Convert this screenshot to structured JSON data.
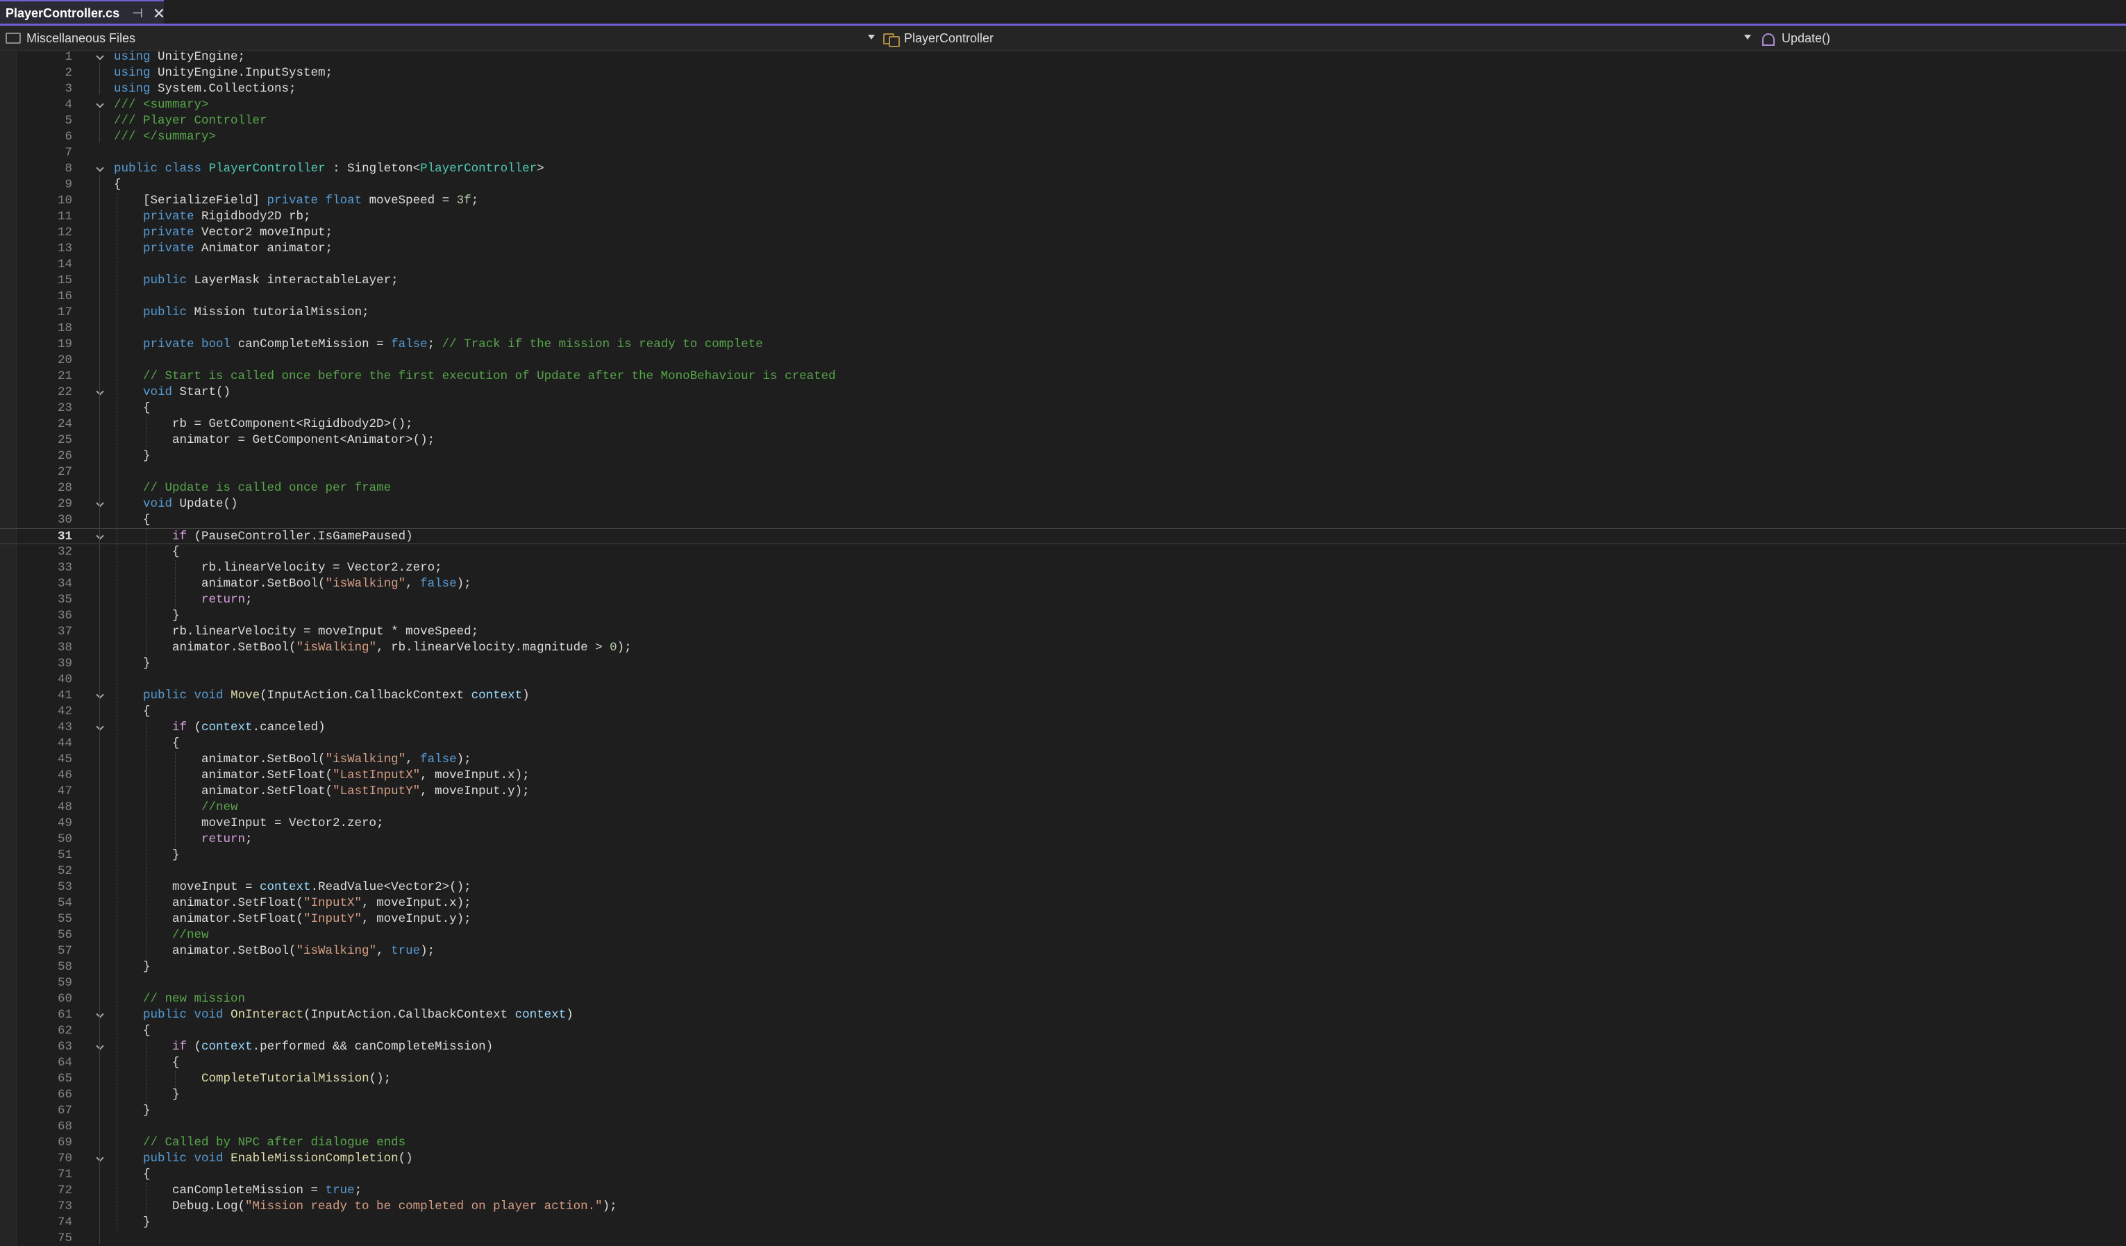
{
  "tab": {
    "title": "PlayerController.cs",
    "pin_glyph": "⊣",
    "close_glyph": "✕"
  },
  "navbar": {
    "project": "Miscellaneous Files",
    "type": "PlayerController",
    "member": "Update()"
  },
  "editor": {
    "current_line": 31,
    "lines": [
      [
        {
          "t": "using",
          "c": "kw"
        },
        {
          "t": " UnityEngine;"
        }
      ],
      [
        {
          "t": "using",
          "c": "kw"
        },
        {
          "t": " UnityEngine.InputSystem;"
        }
      ],
      [
        {
          "t": "using",
          "c": "kw"
        },
        {
          "t": " System.Collections;"
        }
      ],
      [
        {
          "t": "/// <summary>",
          "c": "cm"
        }
      ],
      [
        {
          "t": "/// Player Controller",
          "c": "cm"
        }
      ],
      [
        {
          "t": "/// </summary>",
          "c": "cm"
        }
      ],
      [],
      [
        {
          "t": "public",
          "c": "kw"
        },
        {
          "t": " "
        },
        {
          "t": "class",
          "c": "kw"
        },
        {
          "t": " "
        },
        {
          "t": "PlayerController",
          "c": "ty"
        },
        {
          "t": " : Singleton<"
        },
        {
          "t": "PlayerController",
          "c": "ty"
        },
        {
          "t": ">"
        }
      ],
      [
        {
          "t": "{"
        }
      ],
      [
        {
          "t": "    [SerializeField] "
        },
        {
          "t": "private",
          "c": "kw"
        },
        {
          "t": " "
        },
        {
          "t": "float",
          "c": "kw"
        },
        {
          "t": " moveSpeed = "
        },
        {
          "t": "3f",
          "c": "nu"
        },
        {
          "t": ";"
        }
      ],
      [
        {
          "t": "    "
        },
        {
          "t": "private",
          "c": "kw"
        },
        {
          "t": " Rigidbody2D rb;"
        }
      ],
      [
        {
          "t": "    "
        },
        {
          "t": "private",
          "c": "kw"
        },
        {
          "t": " Vector2 moveInput;"
        }
      ],
      [
        {
          "t": "    "
        },
        {
          "t": "private",
          "c": "kw"
        },
        {
          "t": " Animator animator;"
        }
      ],
      [],
      [
        {
          "t": "    "
        },
        {
          "t": "public",
          "c": "kw"
        },
        {
          "t": " LayerMask interactableLayer;"
        }
      ],
      [],
      [
        {
          "t": "    "
        },
        {
          "t": "public",
          "c": "kw"
        },
        {
          "t": " Mission tutorialMission;"
        }
      ],
      [],
      [
        {
          "t": "    "
        },
        {
          "t": "private",
          "c": "kw"
        },
        {
          "t": " "
        },
        {
          "t": "bool",
          "c": "kw"
        },
        {
          "t": " canCompleteMission = "
        },
        {
          "t": "false",
          "c": "kw"
        },
        {
          "t": "; "
        },
        {
          "t": "// Track if the mission is ready to complete",
          "c": "cm"
        }
      ],
      [],
      [
        {
          "t": "    "
        },
        {
          "t": "// Start is called once before the first execution of Update after the MonoBehaviour is created",
          "c": "cm"
        }
      ],
      [
        {
          "t": "    "
        },
        {
          "t": "void",
          "c": "kw"
        },
        {
          "t": " Start()"
        }
      ],
      [
        {
          "t": "    {"
        }
      ],
      [
        {
          "t": "        rb = GetComponent<Rigidbody2D>();"
        }
      ],
      [
        {
          "t": "        animator = GetComponent<Animator>();"
        }
      ],
      [
        {
          "t": "    }"
        }
      ],
      [],
      [
        {
          "t": "    "
        },
        {
          "t": "// Update is called once per frame",
          "c": "cm"
        }
      ],
      [
        {
          "t": "    "
        },
        {
          "t": "void",
          "c": "kw"
        },
        {
          "t": " Update()"
        }
      ],
      [
        {
          "t": "    {"
        }
      ],
      [
        {
          "t": "        "
        },
        {
          "t": "if",
          "c": "ct"
        },
        {
          "t": " (PauseController.IsGamePaused)"
        }
      ],
      [
        {
          "t": "        {"
        }
      ],
      [
        {
          "t": "            rb.linearVelocity = Vector2.zero;"
        }
      ],
      [
        {
          "t": "            animator.SetBool("
        },
        {
          "t": "\"isWalking\"",
          "c": "st"
        },
        {
          "t": ", "
        },
        {
          "t": "false",
          "c": "kw"
        },
        {
          "t": ");"
        }
      ],
      [
        {
          "t": "            "
        },
        {
          "t": "return",
          "c": "ct"
        },
        {
          "t": ";"
        }
      ],
      [
        {
          "t": "        }"
        }
      ],
      [
        {
          "t": "        rb.linearVelocity = moveInput * moveSpeed;"
        }
      ],
      [
        {
          "t": "        animator.SetBool("
        },
        {
          "t": "\"isWalking\"",
          "c": "st"
        },
        {
          "t": ", rb.linearVelocity.magnitude > "
        },
        {
          "t": "0",
          "c": "nu"
        },
        {
          "t": ");"
        }
      ],
      [
        {
          "t": "    }"
        }
      ],
      [],
      [
        {
          "t": "    "
        },
        {
          "t": "public",
          "c": "kw"
        },
        {
          "t": " "
        },
        {
          "t": "void",
          "c": "kw"
        },
        {
          "t": " "
        },
        {
          "t": "Move",
          "c": "mt"
        },
        {
          "t": "(InputAction.CallbackContext "
        },
        {
          "t": "context",
          "c": "pm"
        },
        {
          "t": ")"
        }
      ],
      [
        {
          "t": "    {"
        }
      ],
      [
        {
          "t": "        "
        },
        {
          "t": "if",
          "c": "ct"
        },
        {
          "t": " ("
        },
        {
          "t": "context",
          "c": "pm"
        },
        {
          "t": ".canceled)"
        }
      ],
      [
        {
          "t": "        {"
        }
      ],
      [
        {
          "t": "            animator.SetBool("
        },
        {
          "t": "\"isWalking\"",
          "c": "st"
        },
        {
          "t": ", "
        },
        {
          "t": "false",
          "c": "kw"
        },
        {
          "t": ");"
        }
      ],
      [
        {
          "t": "            animator.SetFloat("
        },
        {
          "t": "\"LastInputX\"",
          "c": "st"
        },
        {
          "t": ", moveInput.x);"
        }
      ],
      [
        {
          "t": "            animator.SetFloat("
        },
        {
          "t": "\"LastInputY\"",
          "c": "st"
        },
        {
          "t": ", moveInput.y);"
        }
      ],
      [
        {
          "t": "            "
        },
        {
          "t": "//new",
          "c": "cm"
        }
      ],
      [
        {
          "t": "            moveInput = Vector2.zero;"
        }
      ],
      [
        {
          "t": "            "
        },
        {
          "t": "return",
          "c": "ct"
        },
        {
          "t": ";"
        }
      ],
      [
        {
          "t": "        }"
        }
      ],
      [],
      [
        {
          "t": "        moveInput = "
        },
        {
          "t": "context",
          "c": "pm"
        },
        {
          "t": ".ReadValue<Vector2>();"
        }
      ],
      [
        {
          "t": "        animator.SetFloat("
        },
        {
          "t": "\"InputX\"",
          "c": "st"
        },
        {
          "t": ", moveInput.x);"
        }
      ],
      [
        {
          "t": "        animator.SetFloat("
        },
        {
          "t": "\"InputY\"",
          "c": "st"
        },
        {
          "t": ", moveInput.y);"
        }
      ],
      [
        {
          "t": "        "
        },
        {
          "t": "//new",
          "c": "cm"
        }
      ],
      [
        {
          "t": "        animator.SetBool("
        },
        {
          "t": "\"isWalking\"",
          "c": "st"
        },
        {
          "t": ", "
        },
        {
          "t": "true",
          "c": "kw"
        },
        {
          "t": ");"
        }
      ],
      [
        {
          "t": "    }"
        }
      ],
      [],
      [
        {
          "t": "    "
        },
        {
          "t": "// new mission",
          "c": "cm"
        }
      ],
      [
        {
          "t": "    "
        },
        {
          "t": "public",
          "c": "kw"
        },
        {
          "t": " "
        },
        {
          "t": "void",
          "c": "kw"
        },
        {
          "t": " "
        },
        {
          "t": "OnInteract",
          "c": "mt"
        },
        {
          "t": "(InputAction.CallbackContext "
        },
        {
          "t": "context",
          "c": "pm"
        },
        {
          "t": ")"
        }
      ],
      [
        {
          "t": "    {"
        }
      ],
      [
        {
          "t": "        "
        },
        {
          "t": "if",
          "c": "ct"
        },
        {
          "t": " ("
        },
        {
          "t": "context",
          "c": "pm"
        },
        {
          "t": ".performed && canCompleteMission)"
        }
      ],
      [
        {
          "t": "        {"
        }
      ],
      [
        {
          "t": "            "
        },
        {
          "t": "CompleteTutorialMission",
          "c": "mt"
        },
        {
          "t": "();"
        }
      ],
      [
        {
          "t": "        }"
        }
      ],
      [
        {
          "t": "    }"
        }
      ],
      [],
      [
        {
          "t": "    "
        },
        {
          "t": "// Called by NPC after dialogue ends",
          "c": "cm"
        }
      ],
      [
        {
          "t": "    "
        },
        {
          "t": "public",
          "c": "kw"
        },
        {
          "t": " "
        },
        {
          "t": "void",
          "c": "kw"
        },
        {
          "t": " "
        },
        {
          "t": "EnableMissionCompletion",
          "c": "mt"
        },
        {
          "t": "()"
        }
      ],
      [
        {
          "t": "    {"
        }
      ],
      [
        {
          "t": "        canCompleteMission = "
        },
        {
          "t": "true",
          "c": "kw"
        },
        {
          "t": ";"
        }
      ],
      [
        {
          "t": "        Debug.Log("
        },
        {
          "t": "\"Mission ready to be completed on player action.\"",
          "c": "st"
        },
        {
          "t": ");"
        }
      ],
      [
        {
          "t": "    }"
        }
      ],
      []
    ]
  }
}
